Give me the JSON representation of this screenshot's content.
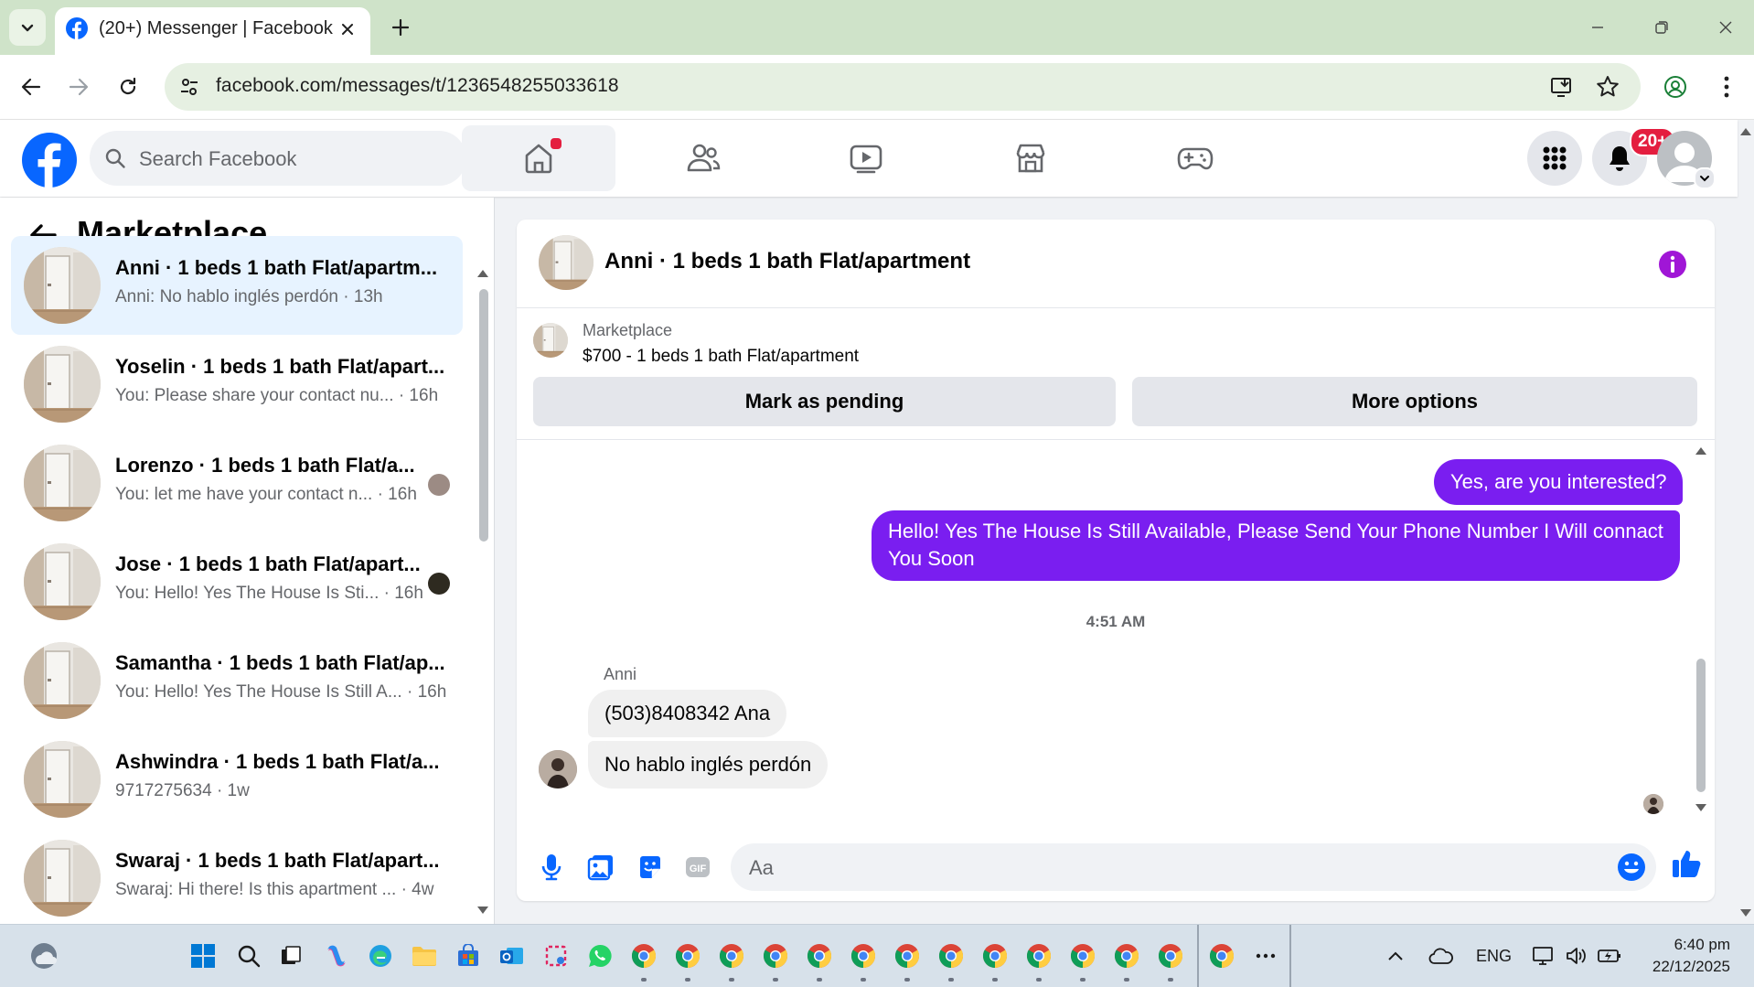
{
  "browser": {
    "tab_title": "(20+) Messenger | Facebook",
    "url": "facebook.com/messages/t/1236548255033618"
  },
  "fb": {
    "search_placeholder": "Search Facebook",
    "notification_badge": "20+",
    "nav_items": [
      "home-icon",
      "friends-icon",
      "video-icon",
      "marketplace-icon",
      "gaming-icon"
    ]
  },
  "left": {
    "title": "Marketplace",
    "conversations": [
      {
        "name": "Anni · 1 beds 1 bath Flat/apartm...",
        "preview": "Anni: No hablo inglés perdón · 13h"
      },
      {
        "name": "Yoselin · 1 beds 1 bath Flat/apart...",
        "preview": "You: Please share your contact nu... · 16h"
      },
      {
        "name": "Lorenzo · 1 beds 1 bath Flat/a...",
        "preview": "You: let me have your contact n... · 16h"
      },
      {
        "name": "Jose · 1 beds 1 bath Flat/apart...",
        "preview": "You: Hello! Yes The House Is Sti... · 16h"
      },
      {
        "name": "Samantha · 1 beds 1 bath Flat/ap...",
        "preview": "You: Hello! Yes The House Is Still A... · 16h"
      },
      {
        "name": "Ashwindra · 1 beds 1 bath Flat/a...",
        "preview": "9717275634 · 1w"
      },
      {
        "name": "Swaraj · 1 beds 1 bath Flat/apart...",
        "preview": "Swaraj: Hi there! Is this apartment ... · 4w"
      }
    ]
  },
  "chat": {
    "title": "Anni · 1 beds 1 bath Flat/apartment",
    "listing_label": "Marketplace",
    "listing_price": "$700 - 1 beds 1 bath Flat/apartment",
    "mark_pending": "Mark as pending",
    "more_options": "More options",
    "outgoing": [
      "Yes, are you interested?",
      "Hello! Yes The House  Is Still Available, Please Send Your Phone Number I Will connact You Soon"
    ],
    "timestamp": "4:51 AM",
    "sender_name": "Anni",
    "incoming": [
      "(503)8408342 Ana",
      "No hablo inglés perdón"
    ],
    "composer_placeholder": "Aa"
  },
  "taskbar": {
    "lang": "ENG",
    "time": "6:40 pm",
    "date": "22/12/2025"
  },
  "colors": {
    "fb_blue": "#0866ff",
    "messenger_purple": "#7a1ef0",
    "badge_red": "#e41e3f",
    "chrome_tint": "#cfe3c9"
  }
}
